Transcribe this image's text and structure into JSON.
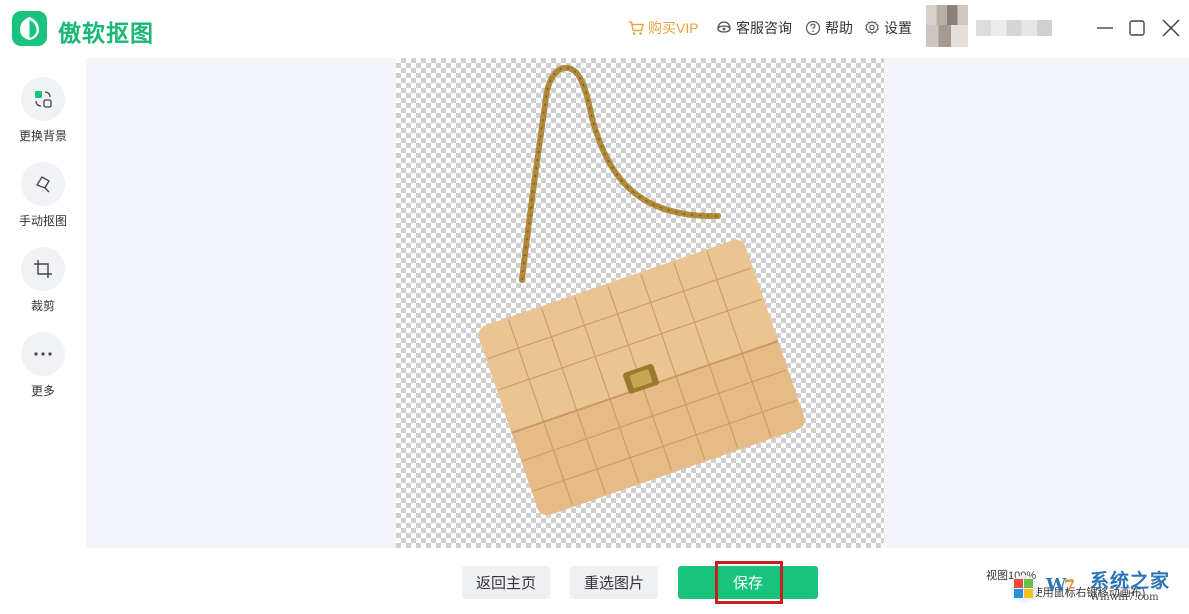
{
  "app": {
    "title": "傲软抠图"
  },
  "topnav": {
    "vip": "购买VIP",
    "service": "客服咨询",
    "help": "帮助",
    "settings": "设置"
  },
  "sidebar": {
    "items": [
      {
        "label": "更换背景",
        "icon": "change-background-icon"
      },
      {
        "label": "手动抠图",
        "icon": "manual-cutout-icon"
      },
      {
        "label": "裁剪",
        "icon": "crop-icon"
      },
      {
        "label": "更多",
        "icon": "more-icon"
      }
    ]
  },
  "bottom": {
    "home_label": "返回主页",
    "reselect_label": "重选图片",
    "save_label": "保存",
    "zoom_text": "视图100%",
    "zoom_hint": "(使用鼠标右键移动画布)"
  },
  "watermark": {
    "brand": "系统之家",
    "url": "Winwin7.com"
  },
  "colors": {
    "accent": "#19c37d",
    "vip": "#e8a33d",
    "highlight": "#c8201e"
  }
}
